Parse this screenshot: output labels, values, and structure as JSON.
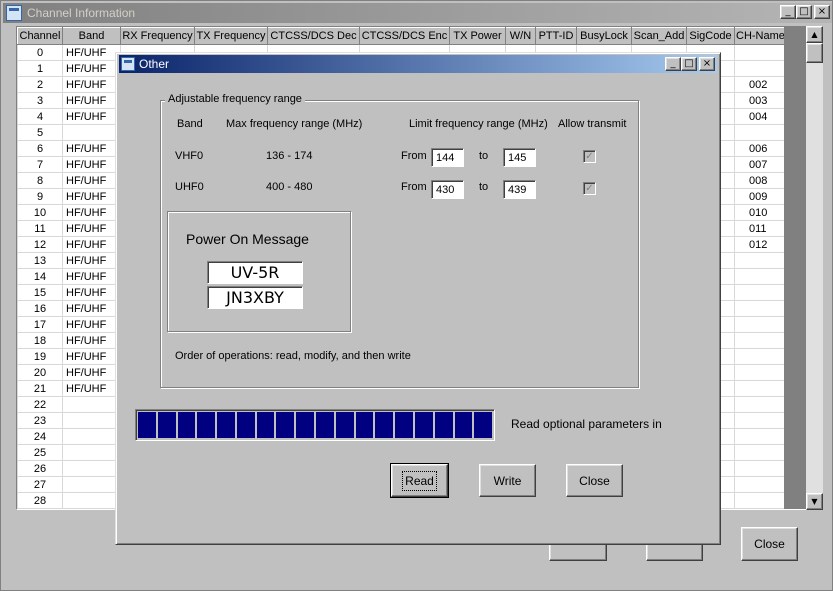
{
  "main_window": {
    "title": "Channel Information",
    "title_buttons": {
      "minimize": "_",
      "maximize": "□",
      "close": "×"
    },
    "columns": [
      "Channel",
      "Band",
      "RX Frequency",
      "TX Frequency",
      "CTCSS/DCS Dec",
      "CTCSS/DCS Enc",
      "TX Power",
      "W/N",
      "PTT-ID",
      "BusyLock",
      "Scan_Add",
      "SigCode",
      "CH-Name"
    ],
    "rows": [
      {
        "channel": "0",
        "band": "HF/UHF",
        "name": ""
      },
      {
        "channel": "1",
        "band": "HF/UHF",
        "name": ""
      },
      {
        "channel": "2",
        "band": "HF/UHF",
        "name": "002"
      },
      {
        "channel": "3",
        "band": "HF/UHF",
        "name": "003"
      },
      {
        "channel": "4",
        "band": "HF/UHF",
        "name": "004"
      },
      {
        "channel": "5",
        "band": "",
        "name": ""
      },
      {
        "channel": "6",
        "band": "HF/UHF",
        "name": "006"
      },
      {
        "channel": "7",
        "band": "HF/UHF",
        "name": "007"
      },
      {
        "channel": "8",
        "band": "HF/UHF",
        "name": "008"
      },
      {
        "channel": "9",
        "band": "HF/UHF",
        "name": "009"
      },
      {
        "channel": "10",
        "band": "HF/UHF",
        "name": "010"
      },
      {
        "channel": "11",
        "band": "HF/UHF",
        "name": "011"
      },
      {
        "channel": "12",
        "band": "HF/UHF",
        "name": "012"
      },
      {
        "channel": "13",
        "band": "HF/UHF",
        "name": ""
      },
      {
        "channel": "14",
        "band": "HF/UHF",
        "name": ""
      },
      {
        "channel": "15",
        "band": "HF/UHF",
        "name": ""
      },
      {
        "channel": "16",
        "band": "HF/UHF",
        "name": ""
      },
      {
        "channel": "17",
        "band": "HF/UHF",
        "name": ""
      },
      {
        "channel": "18",
        "band": "HF/UHF",
        "name": ""
      },
      {
        "channel": "19",
        "band": "HF/UHF",
        "name": ""
      },
      {
        "channel": "20",
        "band": "HF/UHF",
        "name": ""
      },
      {
        "channel": "21",
        "band": "HF/UHF",
        "name": ""
      },
      {
        "channel": "22",
        "band": "",
        "name": ""
      },
      {
        "channel": "23",
        "band": "",
        "name": ""
      },
      {
        "channel": "24",
        "band": "",
        "name": ""
      },
      {
        "channel": "25",
        "band": "",
        "name": ""
      },
      {
        "channel": "26",
        "band": "",
        "name": ""
      },
      {
        "channel": "27",
        "band": "",
        "name": ""
      },
      {
        "channel": "28",
        "band": "",
        "name": ""
      }
    ],
    "close_label": "Close"
  },
  "dialog": {
    "title": "Other",
    "freq_group": {
      "label": "Adjustable  frequency  range",
      "headers": {
        "band": "Band",
        "max": "Max frequency range (MHz)",
        "limit": "Limit frequency range (MHz)",
        "allow": "Allow transmit"
      },
      "rows": [
        {
          "band": "VHF0",
          "max": "136 - 174",
          "from_label": "From",
          "from": "144",
          "to_label": "to",
          "to": "145",
          "allow": true
        },
        {
          "band": "UHF0",
          "max": "400 - 480",
          "from_label": "From",
          "from": "430",
          "to_label": "to",
          "to": "439",
          "allow": true
        }
      ],
      "note": "Order of operations: read, modify, and then write"
    },
    "power_on": {
      "label": "Power On Message",
      "line1": "UV-5R",
      "line2": "JN3XBY"
    },
    "progress": {
      "value": 1.0
    },
    "status": "Read optional parameters in",
    "buttons": {
      "read": "Read",
      "write": "Write",
      "close": "Close"
    }
  },
  "colors": {
    "dialog_title": "#0a246a",
    "progress": "#000080",
    "face": "#c0c0c0"
  }
}
